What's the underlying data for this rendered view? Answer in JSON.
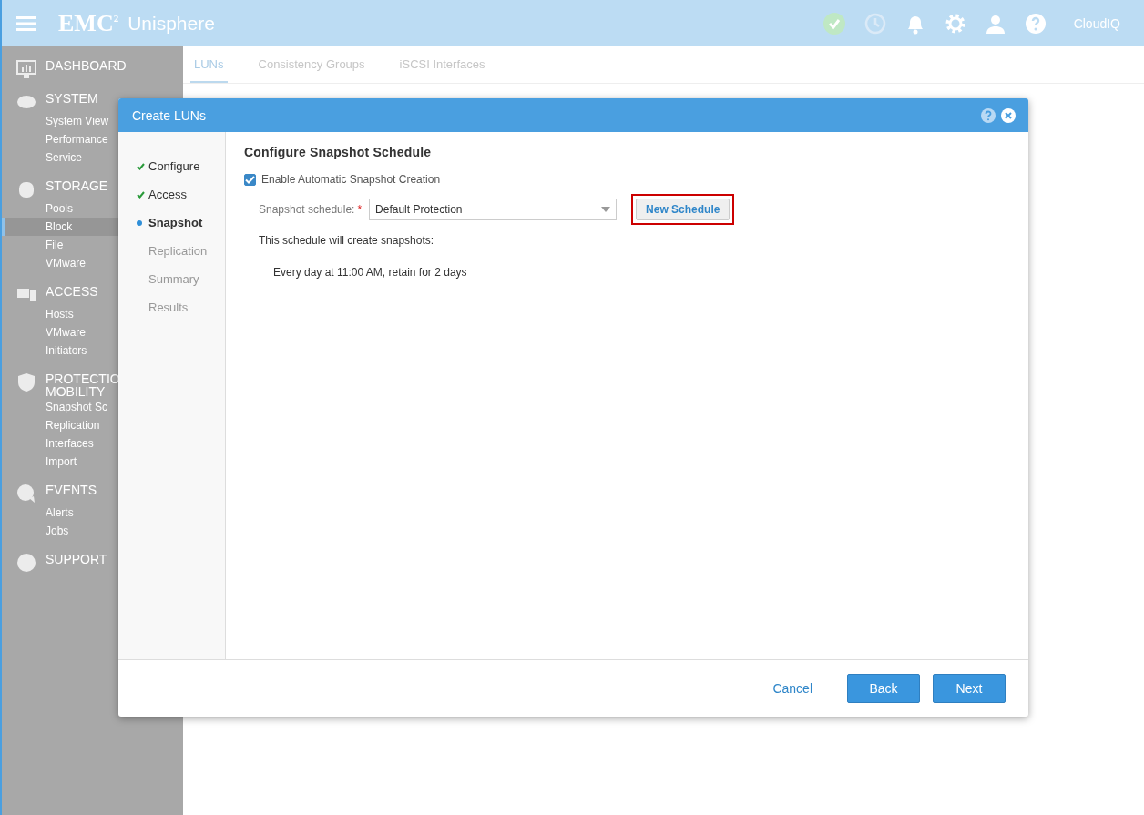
{
  "header": {
    "logo": "EMC$^{2}$",
    "product": "Unisphere",
    "status_ok": true,
    "cloud_label": "CloudIQ"
  },
  "sidebar": {
    "sections": [
      {
        "title_lines": [
          "DASHBOARD"
        ]
      },
      {
        "title_lines": [
          "SYSTEM"
        ],
        "items": [
          {
            "label": "System View",
            "selected": false
          },
          {
            "label": "Performance",
            "selected": false
          },
          {
            "label": "Service",
            "selected": false
          }
        ]
      },
      {
        "title_lines": [
          "STORAGE"
        ],
        "items": [
          {
            "label": "Pools",
            "selected": false
          },
          {
            "label": "Block",
            "selected": true
          },
          {
            "label": "File",
            "selected": false
          },
          {
            "label": "VMware",
            "selected": false
          }
        ]
      },
      {
        "title_lines": [
          "ACCESS"
        ],
        "items": [
          {
            "label": "Hosts",
            "selected": false
          },
          {
            "label": "VMware",
            "selected": false
          },
          {
            "label": "Initiators",
            "selected": false
          }
        ]
      },
      {
        "title_lines": [
          "PROTECTIO",
          "MOBILITY"
        ],
        "items": [
          {
            "label": "Snapshot Sc",
            "selected": false
          },
          {
            "label": "Replication",
            "selected": false
          },
          {
            "label": "Interfaces",
            "selected": false
          },
          {
            "label": "Import",
            "selected": false
          }
        ]
      },
      {
        "title_lines": [
          "EVENTS"
        ],
        "items": [
          {
            "label": "Alerts",
            "selected": false
          },
          {
            "label": "Jobs",
            "selected": false
          }
        ]
      },
      {
        "title_lines": [
          "SUPPORT"
        ]
      }
    ]
  },
  "tabs": [
    {
      "label": "LUNs",
      "selected": true
    },
    {
      "label": "Consistency Groups",
      "selected": false
    },
    {
      "label": "iSCSI Interfaces",
      "selected": false
    }
  ],
  "dialog": {
    "title": "Create LUNs",
    "steps": [
      {
        "label": "Configure",
        "completed": true,
        "selected": false
      },
      {
        "label": "Access",
        "completed": true,
        "selected": false
      },
      {
        "label": "Snapshot",
        "completed": false,
        "selected": true
      },
      {
        "label": "Replication",
        "completed": false,
        "selected": false
      },
      {
        "label": "Summary",
        "completed": false,
        "selected": false
      },
      {
        "label": "Results",
        "completed": false,
        "selected": false
      }
    ],
    "heading": "Configure Snapshot Schedule",
    "enable_checkbox": {
      "label": "Enable Automatic Snapshot Creation",
      "checked": true
    },
    "schedule_field": {
      "label": "Snapshot schedule:",
      "required_mark": "*",
      "value": "Default Protection"
    },
    "new_schedule_button": {
      "label": "New Schedule",
      "highlighted": true
    },
    "summary_intro": "This schedule will create snapshots:",
    "summary_lines": [
      "Every day at 11:00 AM, retain for 2 days"
    ],
    "footer": {
      "cancel": "Cancel",
      "back": "Back",
      "next": "Next"
    }
  }
}
